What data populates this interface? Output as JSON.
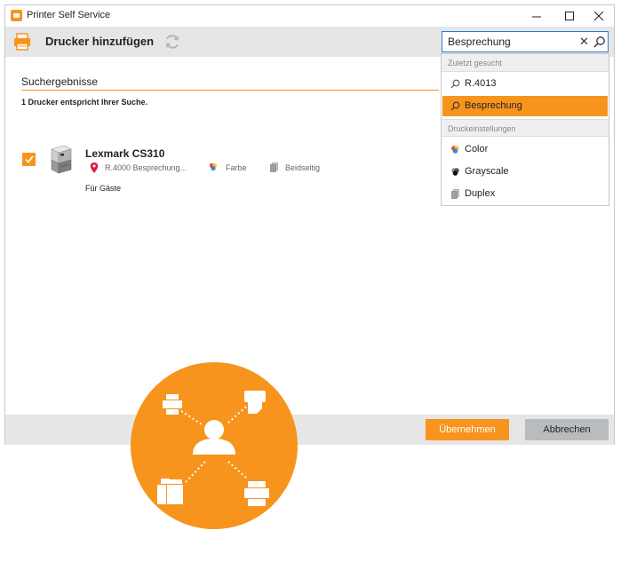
{
  "window": {
    "app_title": "Printer Self Service",
    "controls": {
      "minimize": "—",
      "maximize": "☐",
      "close": "✕"
    }
  },
  "toolbar": {
    "title": "Drucker hinzufügen"
  },
  "search": {
    "value": "Besprechung",
    "clear": "✕"
  },
  "results": {
    "section_title": "Suchergebnisse",
    "count_text": "1 Drucker entspricht Ihrer Suche.",
    "printers": [
      {
        "name": "Lexmark CS310",
        "location": "R.4000 Besprechung...",
        "color": "Farbe",
        "duplex": "Beidseitig",
        "note": "Für Gäste",
        "checked": true
      }
    ]
  },
  "dropdown": {
    "recent_header": "Zuletzt gesucht",
    "recent": [
      "R.4013",
      "Besprechung"
    ],
    "settings_header": "Druckeinstellungen",
    "settings": [
      "Color",
      "Grayscale",
      "Duplex"
    ]
  },
  "footer": {
    "apply": "Übernehmen",
    "cancel": "Abbrechen"
  },
  "colors": {
    "accent": "#f7941d",
    "toolbar_bg": "#e6e6e6",
    "cancel_bg": "#b9bcbf",
    "search_border": "#2b7cd3",
    "location_pin": "#d6213f"
  }
}
